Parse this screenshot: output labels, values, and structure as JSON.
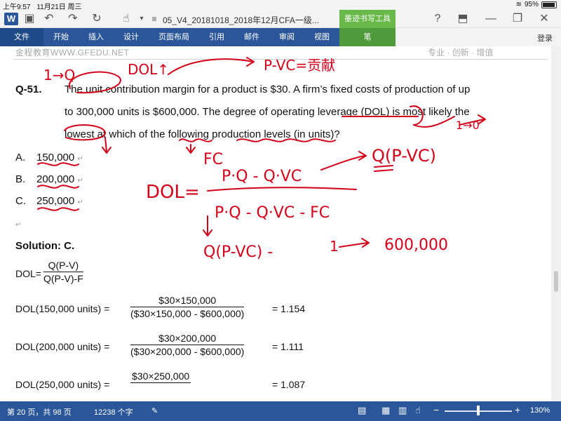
{
  "status": {
    "time": "上午9:57",
    "date": "11月21日 周三",
    "battery": "95%"
  },
  "titlebar": {
    "doc_title": "05_V4_20181018_2018年12月CFA一级...",
    "pen_tools_tab": "墨迹书写工具"
  },
  "ribbon": {
    "file": "文件",
    "tabs": [
      "开始",
      "插入",
      "设计",
      "页面布局",
      "引用",
      "邮件",
      "审阅",
      "视图"
    ],
    "pen_tab": "笔",
    "login": "登录"
  },
  "doc_header": {
    "left": "金程教育WWW.GFEDU.NET",
    "right": "专业 · 创新 · 增值"
  },
  "question": {
    "label": "Q-51.",
    "lines": [
      "The unit contribution margin for a product is $30. A firm’s fixed costs of production of up",
      "to 300,000 units is $600,000. The degree of operating leverage (DOL) is most likely the",
      "lowest at which of the following production levels (in units)?"
    ],
    "options": [
      {
        "letter": "A.",
        "text": "150,000"
      },
      {
        "letter": "B.",
        "text": "200,000"
      },
      {
        "letter": "C.",
        "text": "250,000"
      }
    ]
  },
  "solution": {
    "label": "Solution: C.",
    "dol_prefix": "DOL=",
    "dol_num": "Q(P-V)",
    "dol_den": "Q(P-V)-F",
    "rows": [
      {
        "prefix": "DOL(150,000 units) =",
        "num": "$30×150,000",
        "den": "($30×150,000 - $600,000)",
        "result": "= 1.154"
      },
      {
        "prefix": "DOL(200,000 units) =",
        "num": "$30×200,000",
        "den": "($30×200,000 - $600,000)",
        "result": "= 1.111"
      },
      {
        "prefix": "DOL(250,000 units) =",
        "num": "$30×250,000",
        "den": "",
        "result": "= 1.087"
      }
    ]
  },
  "ink": {
    "colors": {
      "ink": "#d4001a"
    },
    "notes": [
      "1→Q",
      "DOL↑",
      "P-VC=贡献",
      "FC",
      "DOL=",
      "P·Q - Q·VC",
      "P·Q - Q·VC - FC",
      "Q(P-VC)",
      "Q(P-VC) -",
      "1",
      "600,000",
      "1→0"
    ]
  },
  "statusbar": {
    "page": "第 20 页，共 98 页",
    "words": "12238 个字",
    "zoom": "130%"
  }
}
